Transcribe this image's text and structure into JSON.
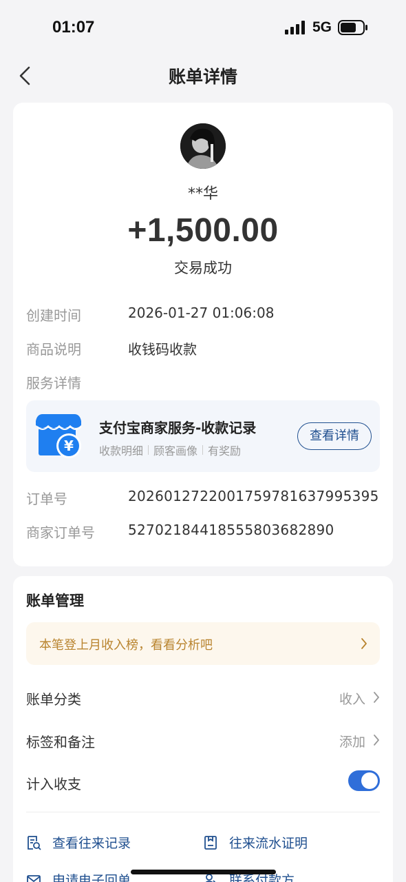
{
  "status_bar": {
    "time": "01:07",
    "network": "5G",
    "icons": [
      "signal-icon",
      "battery-icon"
    ]
  },
  "nav": {
    "title": "账单详情",
    "back_icon": "back-icon"
  },
  "transaction": {
    "payer_name": "**华",
    "amount": "+1,500.00",
    "status": "交易成功",
    "details": [
      {
        "label": "创建时间",
        "value": "2026-01-27 01:06:08"
      },
      {
        "label": "商品说明",
        "value": "收钱码收款"
      },
      {
        "label": "服务详情",
        "value": ""
      }
    ],
    "merchant_service": {
      "title": "支付宝商家服务-收款记录",
      "tags": [
        "收款明细",
        "顾客画像",
        "有奖励"
      ],
      "button_label": "查看详情",
      "icon": "shop-icon"
    },
    "order_no_label": "订单号",
    "order_no": "2026012722001759781637995395",
    "merchant_order_label": "商家订单号",
    "merchant_order_no": "5270218441855580368289​0"
  },
  "management": {
    "title": "账单管理",
    "insight": "本笔登上月收入榜，看看分析吧",
    "category_label": "账单分类",
    "category_value": "收入",
    "tags_label": "标签和备注",
    "tags_value": "添加",
    "count_label": "计入收支",
    "count_enabled": true,
    "links": [
      {
        "label": "查看往来记录",
        "icon": "record-search-icon"
      },
      {
        "label": "往来流水证明",
        "icon": "document-icon"
      },
      {
        "label": "申请电子回单",
        "icon": "mail-icon"
      },
      {
        "label": "联系付款方",
        "icon": "contact-icon"
      }
    ]
  },
  "colors": {
    "background": "#f4f4f6",
    "link_blue": "#1f4f8f",
    "toggle_blue": "#2f6ed9",
    "insight_text": "#b9842f",
    "insight_bg": "#fdf7ed"
  }
}
